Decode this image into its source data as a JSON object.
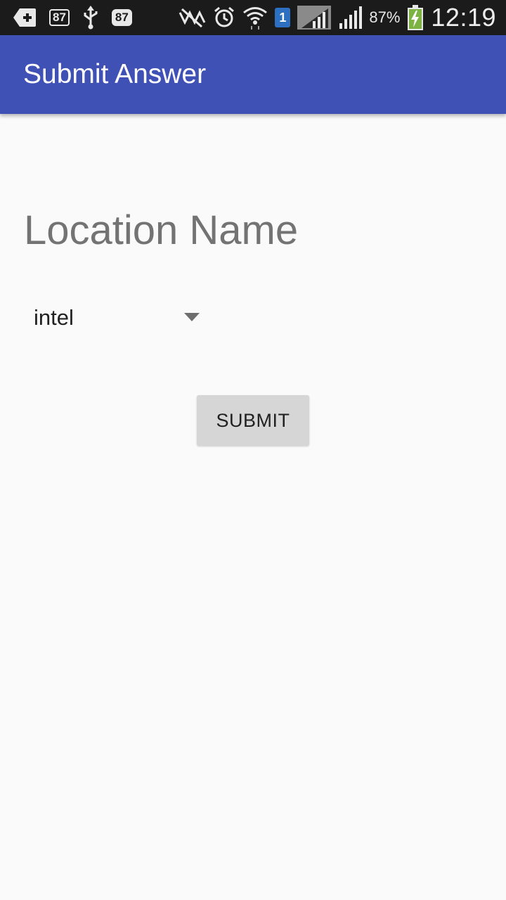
{
  "status_bar": {
    "left_icons": [
      "add-notification-icon",
      "sync-87-icon",
      "usb-icon",
      "notification-87-icon"
    ],
    "left_badge_1": "87",
    "left_badge_2": "87",
    "right_icons": [
      "nfc-muted-icon",
      "alarm-icon",
      "wifi-icon",
      "sim-1-icon",
      "signal-1-icon",
      "signal-2-icon",
      "battery-charging-icon"
    ],
    "sim_label": "1",
    "battery_percent": "87%",
    "time": "12:19"
  },
  "app_bar": {
    "title": "Submit Answer",
    "color": "#3f51b5"
  },
  "form": {
    "heading": "Location Name",
    "spinner_value": "intel",
    "submit_label": "SUBMIT"
  }
}
